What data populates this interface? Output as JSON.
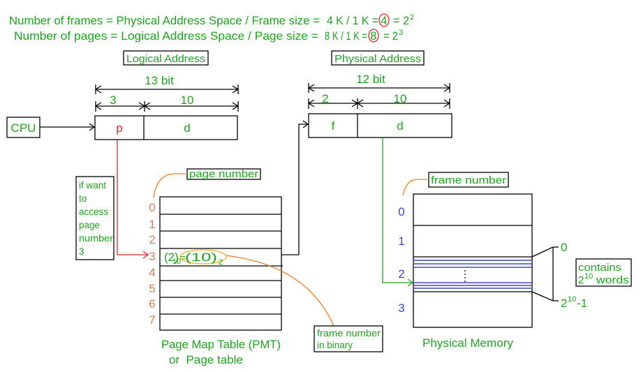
{
  "colors": {
    "text_green": "#1fa31f",
    "pointer_red": "#e8242c",
    "page_label_brown": "#c48662",
    "frame_label_blue": "#3f48cc",
    "callout_orange": "#f07d1e",
    "highlight_yellow": "#f0b020"
  },
  "header": {
    "frames_line": {
      "lhs": "Number of frames = Physical Address Space / Frame size =",
      "calc": "4 K / 1 K =",
      "result": "4",
      "eq": "= 2",
      "exp": "2"
    },
    "pages_line": {
      "lhs": "Number of pages = Logical Address Space / Page size =",
      "calc": "8 K / 1 K =",
      "result": "8",
      "eq": "= 2",
      "exp": "3"
    }
  },
  "cpu": {
    "label": "CPU"
  },
  "logical_address": {
    "title": "Logical Address",
    "total_bits": "13 bit",
    "p_bits": "3",
    "d_bits": "10",
    "p_label": "p",
    "d_label": "d"
  },
  "physical_address": {
    "title": "Physical Address",
    "total_bits": "12 bit",
    "f_bits": "2",
    "d_bits": "10",
    "f_label": "f",
    "d_label": "d"
  },
  "note": {
    "lines": [
      "if want",
      "to",
      "access",
      "page",
      "number",
      "3"
    ]
  },
  "page_table": {
    "callout": "page number",
    "row_labels": [
      "0",
      "1",
      "2",
      "3",
      "4",
      "5",
      "6",
      "7"
    ],
    "entry": {
      "decimal": "(2)",
      "decimal_base": "10",
      "equals": "=",
      "binary": "(10)",
      "binary_base": "2"
    },
    "binary_note": [
      "frame number",
      "in binary"
    ],
    "caption_line1": "Page Map Table (PMT)",
    "caption_line2": "or  Page table"
  },
  "physical_memory": {
    "callout": "frame number",
    "frame_labels": [
      "0",
      "1",
      "2",
      "3"
    ],
    "word_first": "0",
    "word_last_base": "2",
    "word_last_exp": "10",
    "word_last_suffix": "-1",
    "contains_line1": "contains",
    "contains_base": "2",
    "contains_exp": "10",
    "contains_suffix": " words",
    "caption": "Physical Memory"
  }
}
